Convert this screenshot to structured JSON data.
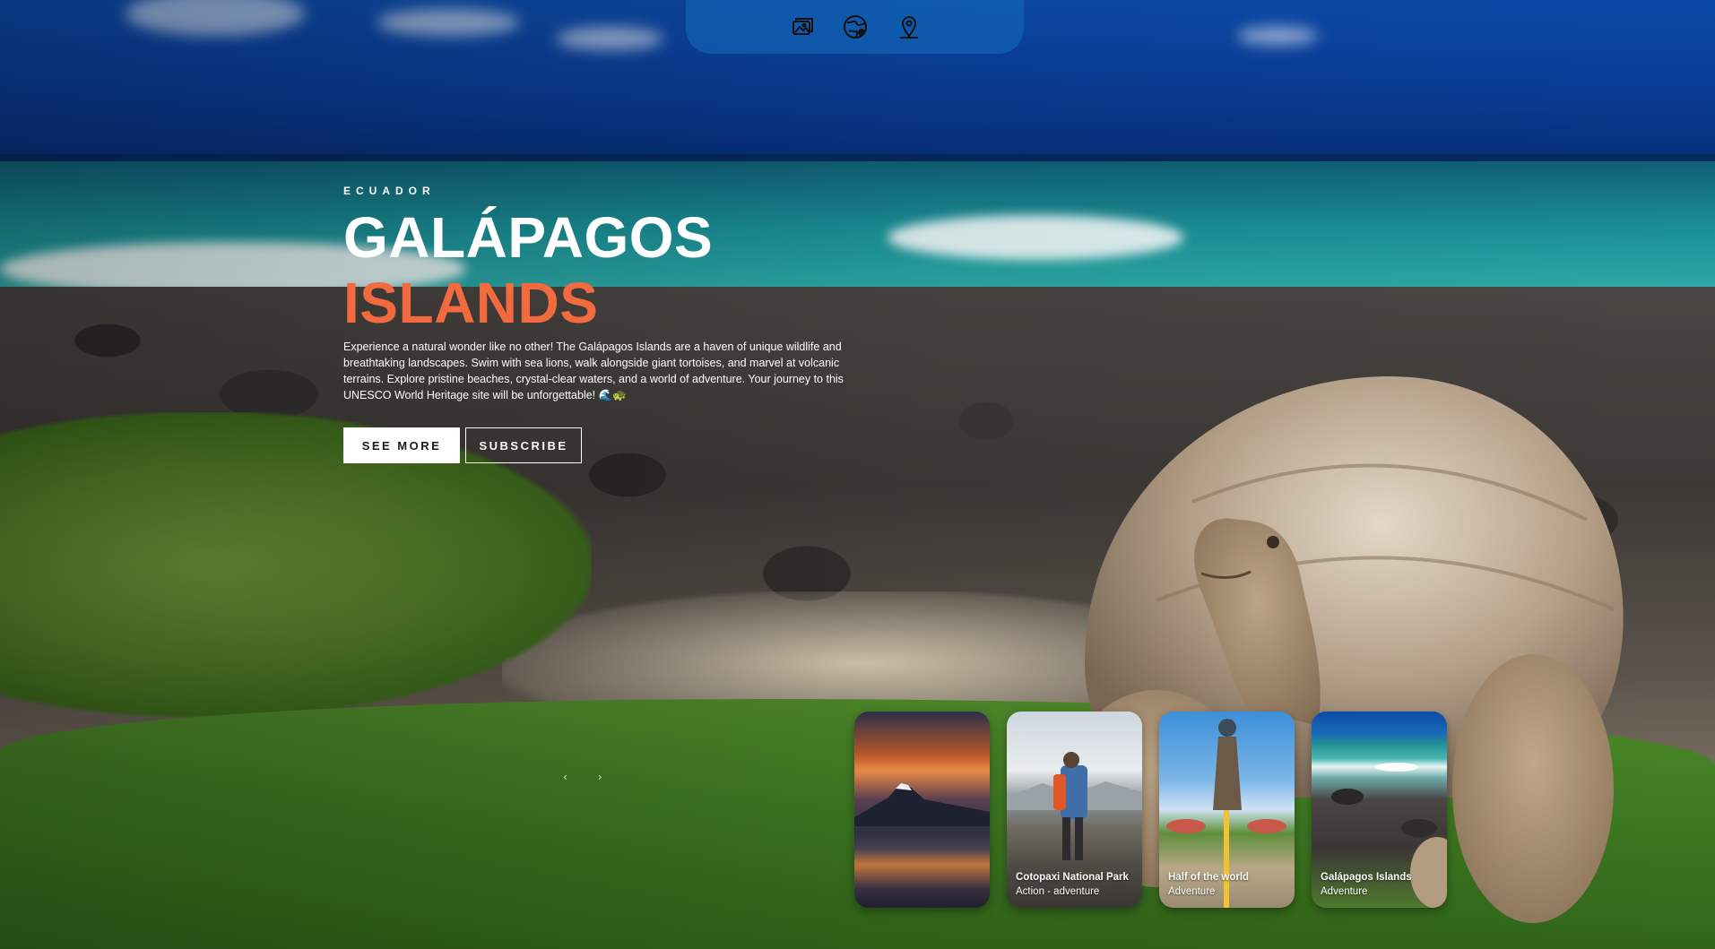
{
  "nav": {
    "icons": [
      "gallery-icon",
      "globe-icon",
      "map-pin-icon"
    ]
  },
  "hero": {
    "country": "ECUADOR",
    "title_line1": "GALÁPAGOS",
    "title_line2": "ISLANDS",
    "description": "Experience a natural wonder like no other! The Galápagos Islands are a haven of unique wildlife and breathtaking landscapes. Swim with sea lions, walk alongside giant tortoises, and marvel at volcanic terrains. Explore pristine beaches, crystal-clear waters, and a world of adventure. Your journey to this UNESCO World Heritage site will be unforgettable! 🌊🐢",
    "see_more_label": "SEE MORE",
    "subscribe_label": "SUBSCRIBE",
    "accent_color": "#f26a3d"
  },
  "slider": {
    "prev": "‹",
    "next": "›"
  },
  "cards": [
    {
      "title": "",
      "subtitle": ""
    },
    {
      "title": "Cotopaxi National Park",
      "subtitle": "Action - adventure"
    },
    {
      "title": "Half of the world",
      "subtitle": "Adventure"
    },
    {
      "title": "Galápagos Islands",
      "subtitle": "Adventure"
    }
  ]
}
